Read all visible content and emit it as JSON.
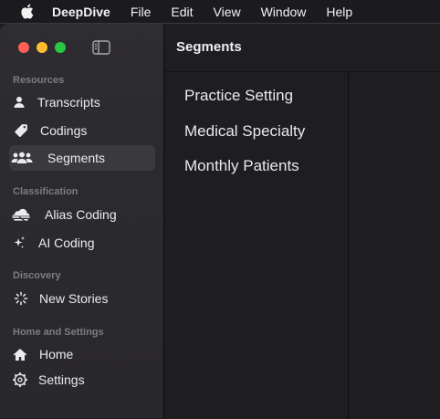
{
  "menubar": {
    "apple_icon": "apple-logo-icon",
    "app_name": "DeepDive",
    "items": [
      "File",
      "Edit",
      "View",
      "Window",
      "Help"
    ]
  },
  "window": {
    "title": "Segments",
    "traffic_lights": {
      "close": "#ff5f57",
      "minimize": "#febc2e",
      "zoom": "#28c840"
    }
  },
  "sidebar": {
    "sections": [
      {
        "label": "Resources",
        "items": [
          {
            "label": "Transcripts",
            "icon": "person-icon"
          },
          {
            "label": "Codings",
            "icon": "tag-icon"
          },
          {
            "label": "Segments",
            "icon": "people-group-icon",
            "selected": true
          }
        ]
      },
      {
        "label": "Classification",
        "items": [
          {
            "label": "Alias Coding",
            "icon": "cloud-stack-icon"
          },
          {
            "label": "AI Coding",
            "icon": "sparkles-icon"
          }
        ]
      },
      {
        "label": "Discovery",
        "items": [
          {
            "label": "New Stories",
            "icon": "loading-spinner-icon"
          }
        ]
      },
      {
        "label": "Home and Settings",
        "items": [
          {
            "label": "Home",
            "icon": "house-icon"
          },
          {
            "label": "Settings",
            "icon": "gear-icon"
          }
        ]
      }
    ]
  },
  "segments": [
    "Practice Setting",
    "Medical Specialty",
    "Monthly Patients"
  ]
}
